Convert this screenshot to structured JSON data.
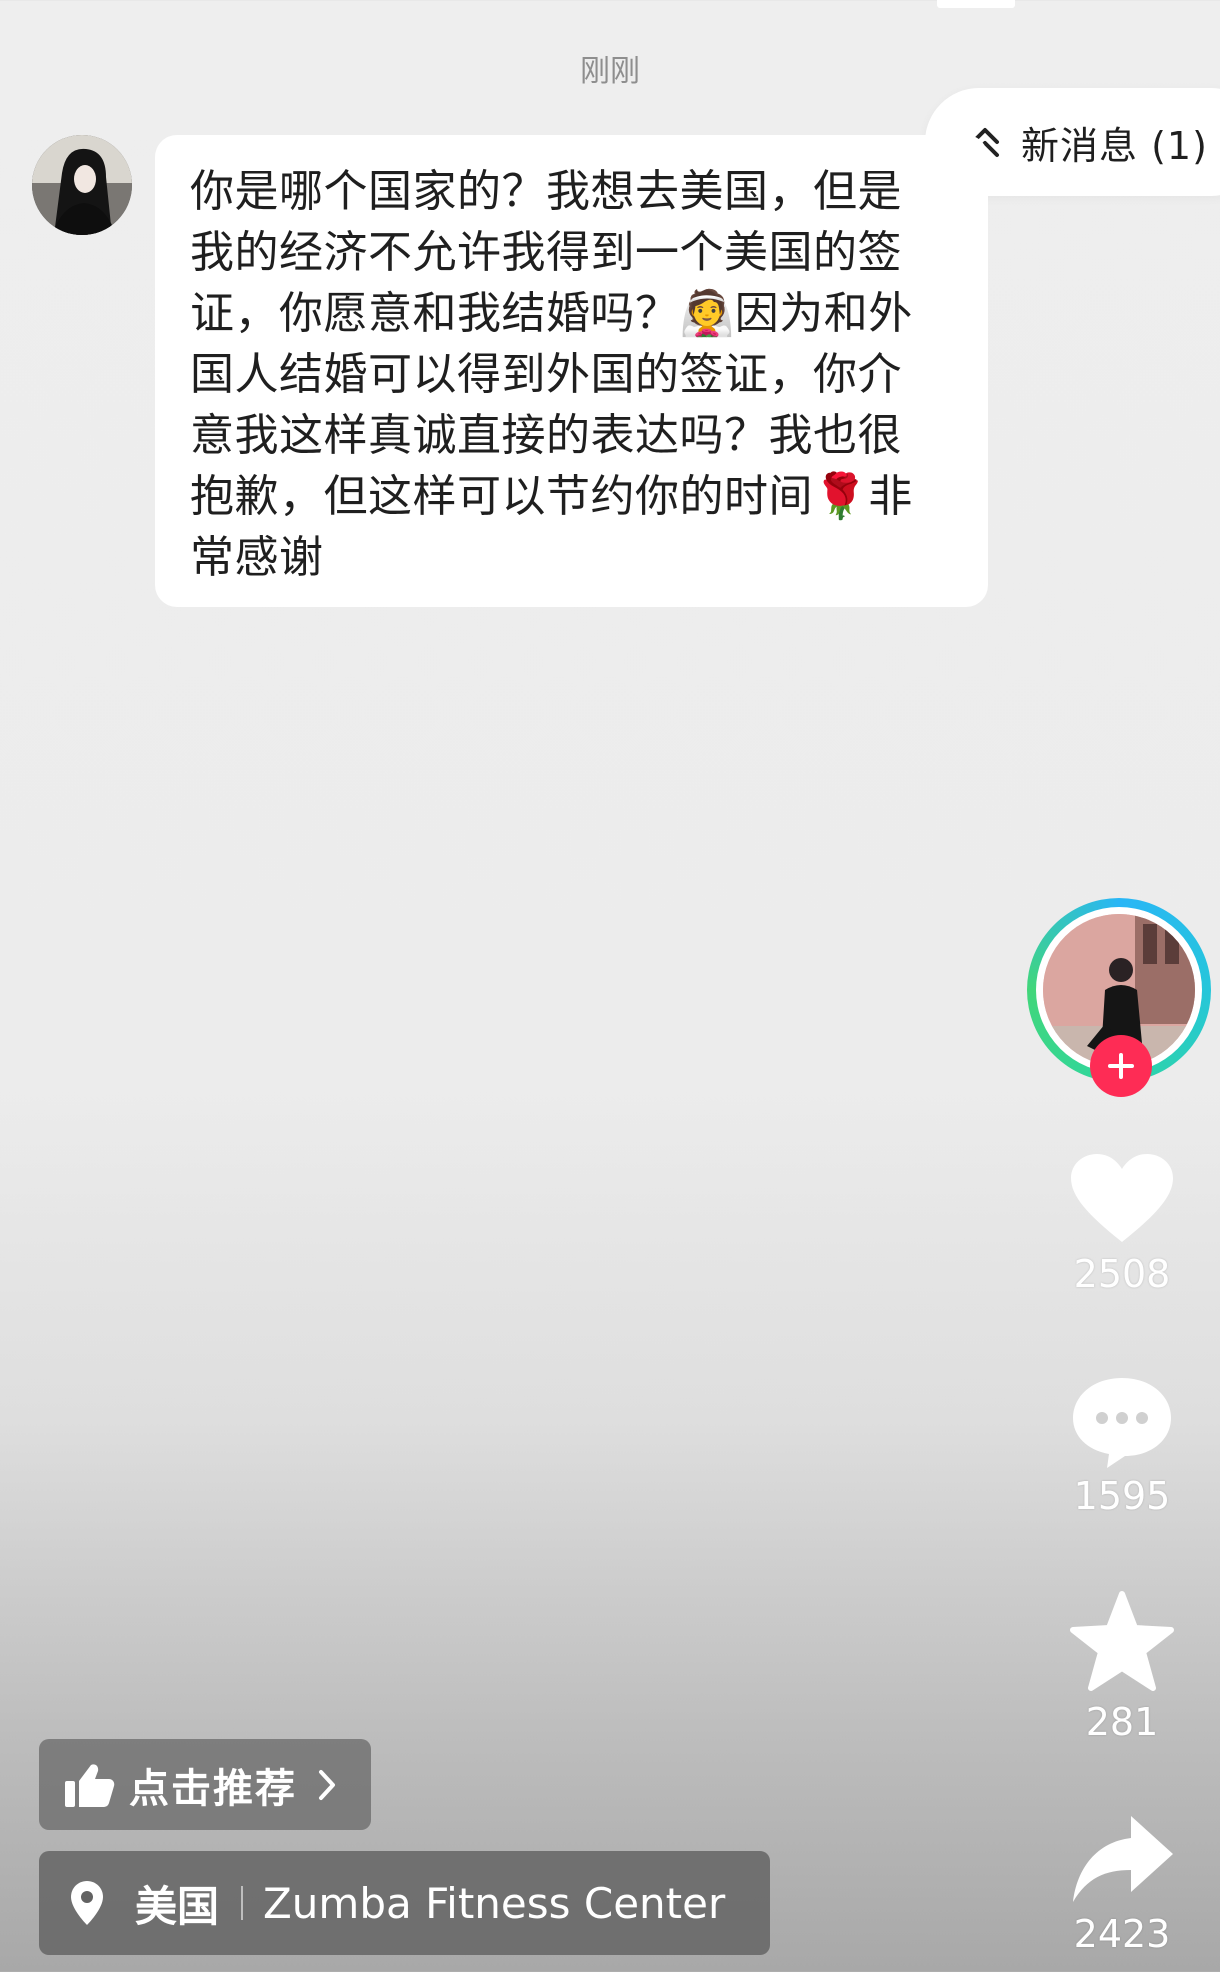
{
  "header": {
    "timestamp": "刚刚"
  },
  "new_message": {
    "label": "新消息 (1)"
  },
  "message": {
    "lines": [
      "你是哪个国家的？我想去美国，但是",
      "我的经济不允许我得到一个美国的签",
      "证，你愿意和我结婚吗？👰因为和外",
      "国人结婚可以得到外国的签证，你介",
      "意我这样真诚直接的表达吗？我也很",
      "抱歉，但这样可以节约你的时间🌹非",
      "常感谢"
    ]
  },
  "rail": {
    "likes": "2508",
    "comments": "1595",
    "favorites": "281",
    "shares": "2423"
  },
  "bottom": {
    "recommend_label": "点击推荐",
    "location_country": "美国",
    "location_place": "Zumba Fitness Center"
  },
  "colors": {
    "follow_plus": "#fe2c55",
    "avatar_ring": "#2ed6a0"
  },
  "icons": [
    "chevrons-up-icon",
    "plus-icon",
    "heart-icon",
    "comment-icon",
    "star-icon",
    "share-icon",
    "thumbs-up-icon",
    "chevron-right-icon",
    "location-pin-icon"
  ]
}
